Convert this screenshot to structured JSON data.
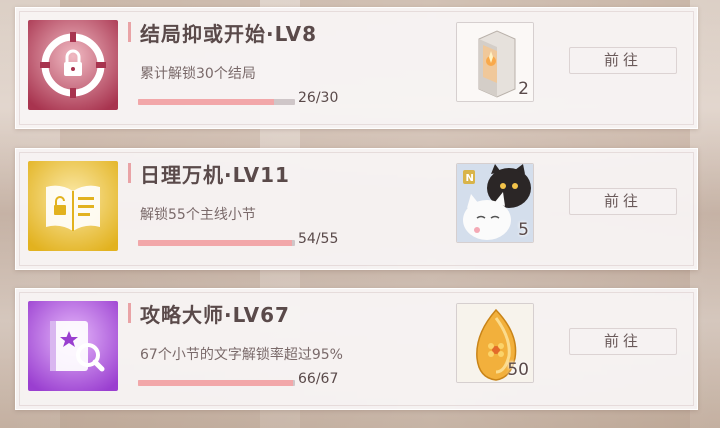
{
  "achievements": [
    {
      "title": "结局抑或开始·LV8",
      "description": "累计解锁30个结局",
      "progress_text": "26/30",
      "progress": 0.867,
      "badge_icon": "lock-target-icon",
      "badge_color": "#a8344f",
      "reward_icon": "crystal-lamp-icon",
      "reward_qty": "2",
      "button_label": "前往"
    },
    {
      "title": "日理万机·LV11",
      "description": "解锁55个主线小节",
      "progress_text": "54/55",
      "progress": 0.982,
      "badge_icon": "open-book-icon",
      "badge_color": "#e2b21f",
      "reward_icon": "cat-card-icon",
      "reward_qty": "5",
      "button_label": "前往"
    },
    {
      "title": "攻略大师·LV67",
      "description": "67个小节的文字解锁率超过95%",
      "progress_text": "66/67",
      "progress": 0.985,
      "badge_icon": "guide-book-magnifier-icon",
      "badge_color": "#9a3fd0",
      "reward_icon": "amber-flower-icon",
      "reward_qty": "50",
      "button_label": "前往"
    }
  ]
}
